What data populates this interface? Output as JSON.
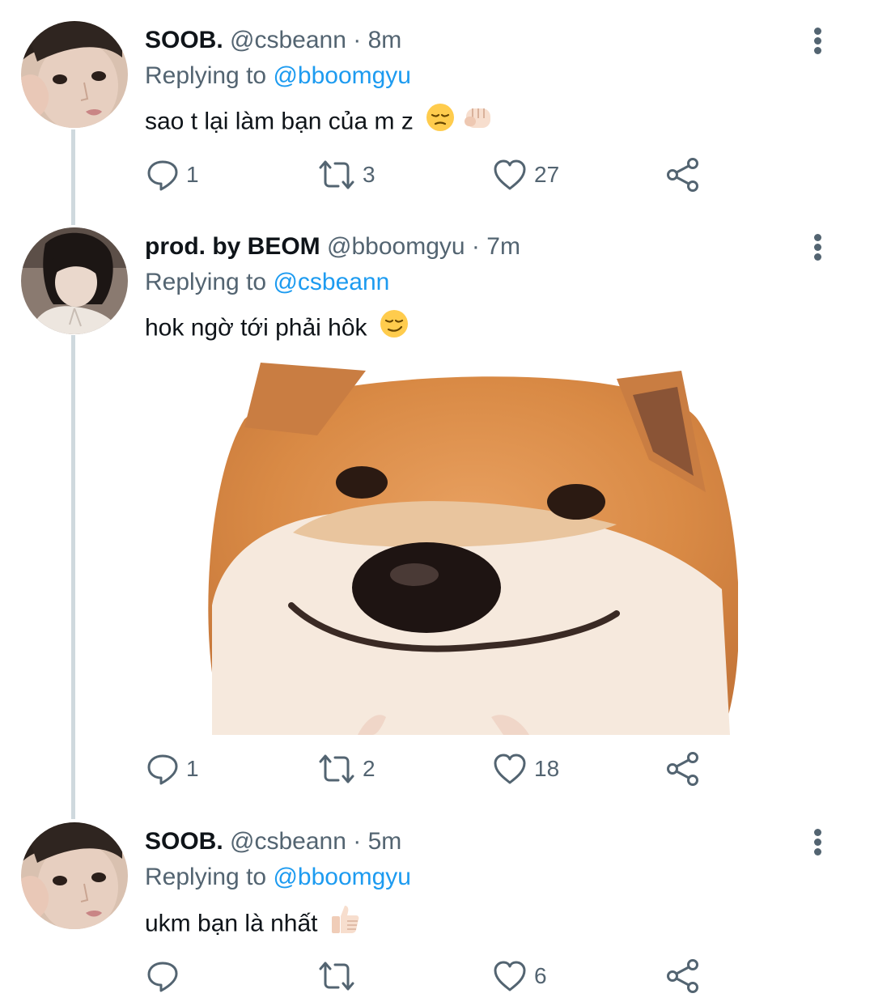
{
  "tweets": [
    {
      "name": "SOOB.",
      "handle": "@csbeann",
      "separator": "·",
      "time": "8m",
      "replying_label": "Replying to",
      "replying_to": "@bboomgyu",
      "text": "sao t lại làm bạn của m z",
      "emojis": [
        "pensive-face",
        "fist-bump-light-skin"
      ],
      "actions": {
        "reply": "1",
        "retweet": "3",
        "like": "27"
      }
    },
    {
      "name": "prod. by BEOM",
      "handle": "@bboomgyu",
      "separator": "·",
      "time": "7m",
      "replying_label": "Replying to",
      "replying_to": "@csbeann",
      "text": "hok ngờ tới phải hôk",
      "emojis": [
        "smirking-face"
      ],
      "media": "shiba-inu-smiling-meme",
      "actions": {
        "reply": "1",
        "retweet": "2",
        "like": "18"
      }
    },
    {
      "name": "SOOB.",
      "handle": "@csbeann",
      "separator": "·",
      "time": "5m",
      "replying_label": "Replying to",
      "replying_to": "@bboomgyu",
      "text": "ukm bạn là nhất",
      "emojis": [
        "thumbs-up-light-skin"
      ],
      "actions": {
        "reply": "",
        "retweet": "",
        "like": "6"
      }
    }
  ],
  "colors": {
    "text": "#0f1419",
    "secondary": "#536471",
    "link": "#1d9bf0",
    "thread_line": "#cfd9de"
  }
}
